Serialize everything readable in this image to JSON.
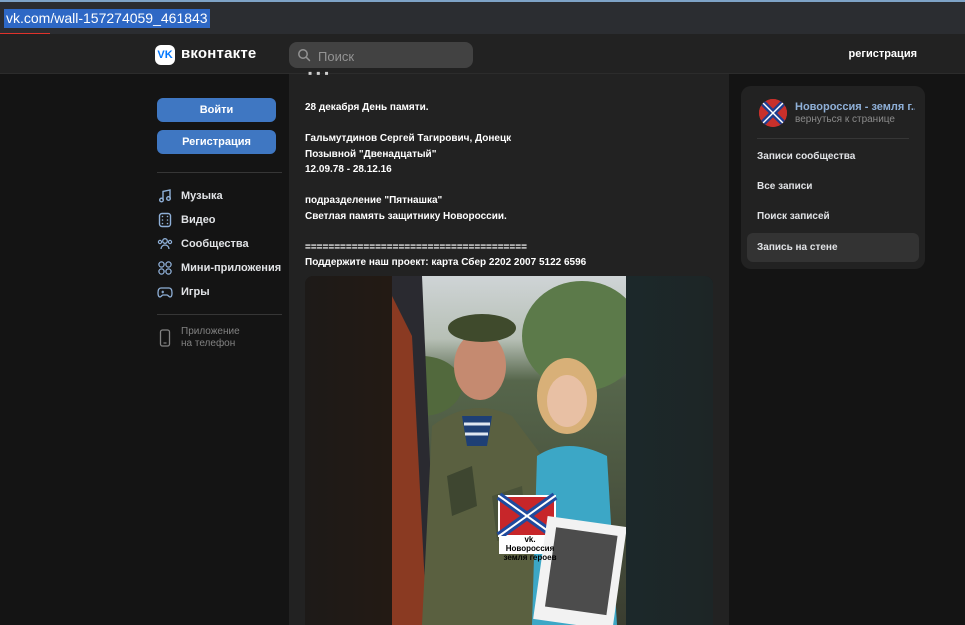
{
  "browser": {
    "url": "vk.com/wall-157274059_461843"
  },
  "header": {
    "brand": "вконтакте",
    "logo_text": "VK",
    "search_placeholder": "Поиск",
    "register_link": "регистрация"
  },
  "sidebar": {
    "login_button": "Войти",
    "register_button": "Регистрация",
    "items": [
      {
        "label": "Музыка",
        "icon": "music-icon"
      },
      {
        "label": "Видео",
        "icon": "video-icon"
      },
      {
        "label": "Сообщества",
        "icon": "communities-icon"
      },
      {
        "label": "Мини-приложения",
        "icon": "mini-apps-icon"
      },
      {
        "label": "Игры",
        "icon": "games-icon"
      }
    ],
    "app_link_line1": "Приложение",
    "app_link_line2": "на телефон"
  },
  "post": {
    "lines": [
      "28 декабря День памяти.",
      "",
      "Гальмутдинов Сергей Тагирович, Донецк",
      "Позывной \"Двенадцатый\"",
      "12.09.78 - 28.12.16",
      "",
      "подразделение \"Пятнашка\"",
      "Светлая память защитнику Новороссии.",
      "",
      "======================================",
      "Поддержите наш проект: карта Сбер 2202 2007 5122 6596"
    ],
    "photo_watermark_line1": "vk. Новороссия",
    "photo_watermark_line2": "земля героев"
  },
  "community": {
    "name": "Новороссия - земля г...",
    "back_link": "вернуться к странице",
    "menu": [
      {
        "label": "Записи сообщества",
        "active": false
      },
      {
        "label": "Все записи",
        "active": false
      },
      {
        "label": "Поиск записей",
        "active": false
      },
      {
        "label": "Запись на стене",
        "active": true
      }
    ]
  },
  "colors": {
    "accent": "#3f77c2",
    "background": "#141414",
    "panel": "#222222",
    "link": "#8fb0d8"
  }
}
